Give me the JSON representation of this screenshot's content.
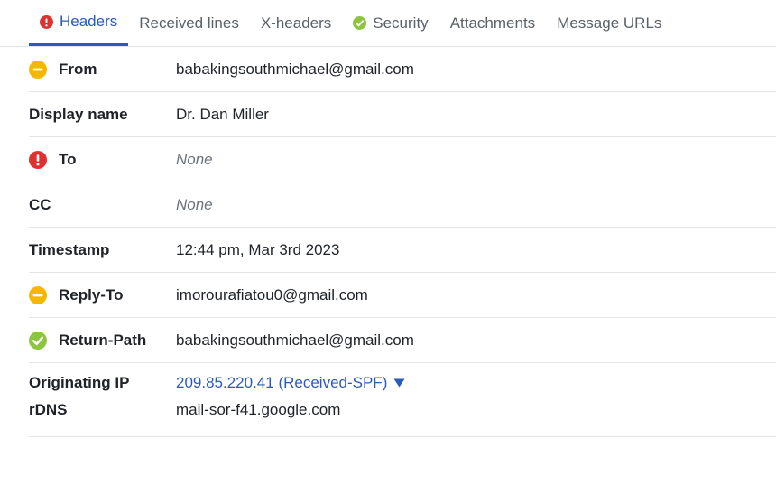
{
  "tabs": [
    {
      "label": "Headers",
      "icon": "error-icon",
      "active": true
    },
    {
      "label": "Received lines"
    },
    {
      "label": "X-headers"
    },
    {
      "label": "Security",
      "icon": "check-icon"
    },
    {
      "label": "Attachments"
    },
    {
      "label": "Message URLs"
    }
  ],
  "rows": {
    "from": {
      "label": "From",
      "value": "babakingsouthmichael@gmail.com",
      "status": "warning"
    },
    "display_name": {
      "label": "Display name",
      "value": "Dr. Dan Miller"
    },
    "to": {
      "label": "To",
      "value": "None",
      "status": "error"
    },
    "cc": {
      "label": "CC",
      "value": "None"
    },
    "timestamp": {
      "label": "Timestamp",
      "value": "12:44 pm, Mar 3rd 2023"
    },
    "reply_to": {
      "label": "Reply-To",
      "value": "imorourafiatou0@gmail.com",
      "status": "warning"
    },
    "return_path": {
      "label": "Return-Path",
      "value": "babakingsouthmichael@gmail.com",
      "status": "pass"
    },
    "originating_ip": {
      "label": "Originating IP",
      "value": "209.85.220.41 (Received-SPF)"
    },
    "rdns": {
      "label": "rDNS",
      "value": "mail-sor-f41.google.com"
    }
  },
  "colors": {
    "accent": "#2a5bb8",
    "warning": "#f5b800",
    "error": "#e03131",
    "pass": "#8cc63f"
  }
}
